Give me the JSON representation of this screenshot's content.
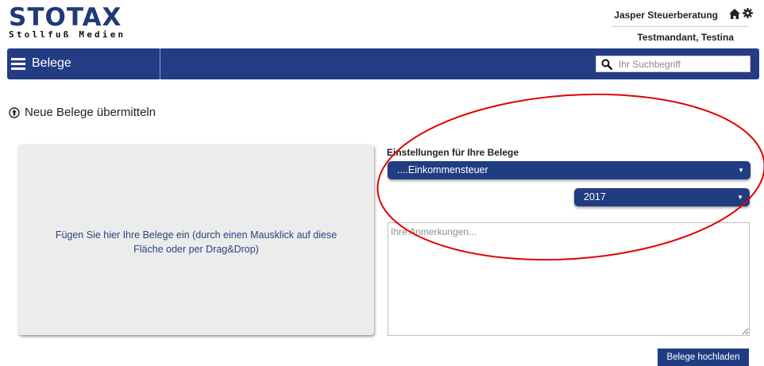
{
  "brand": {
    "name": "STOTAX",
    "tagline": "Stollfuß Medien"
  },
  "header": {
    "user_name": "Jasper Steuerberatung",
    "mandant": "Testmandant, Testina"
  },
  "navbar": {
    "menu_label": "Belege",
    "search_placeholder": "Ihr Suchbegriff",
    "search_value": ""
  },
  "page": {
    "section_title": "Neue Belege übermitteln"
  },
  "dropzone": {
    "text": "Fügen Sie hier Ihre Belege ein (durch einen Mausklick auf diese Fläche oder per Drag&Drop)"
  },
  "settings": {
    "label": "Einstellungen für Ihre Belege",
    "type_selected": "....Einkommensteuer",
    "year_selected": "2017",
    "notes_placeholder": "Ihre Anmerkungen...",
    "notes_value": ""
  },
  "actions": {
    "upload_label": "Belege hochladen"
  },
  "colors": {
    "brand": "#233c84",
    "annotation": "#e00000",
    "dropzone_bg": "#ececec",
    "text_link": "#2d4280"
  },
  "icons": [
    "home-icon",
    "gear-icon",
    "menu-icon",
    "search-icon",
    "upload-circle-icon"
  ]
}
